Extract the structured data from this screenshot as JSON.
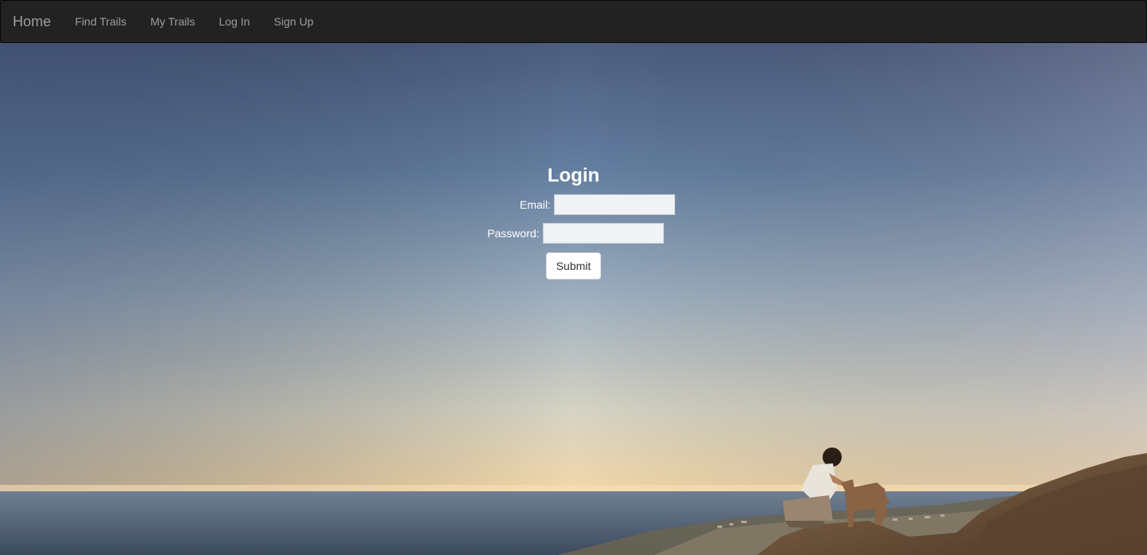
{
  "navbar": {
    "brand": "Home",
    "items": [
      {
        "label": "Find Trails"
      },
      {
        "label": "My Trails"
      },
      {
        "label": "Log In"
      },
      {
        "label": "Sign Up"
      }
    ]
  },
  "login": {
    "title": "Login",
    "email_label": "Email:",
    "email_value": "",
    "password_label": "Password:",
    "password_value": "",
    "submit_label": "Submit"
  },
  "colors": {
    "navbar_bg": "#222222",
    "nav_text": "#9d9d9d",
    "sky_top": "#4d5f84",
    "sky_bottom": "#f1d3a6",
    "sea": "#4b5a6e"
  }
}
